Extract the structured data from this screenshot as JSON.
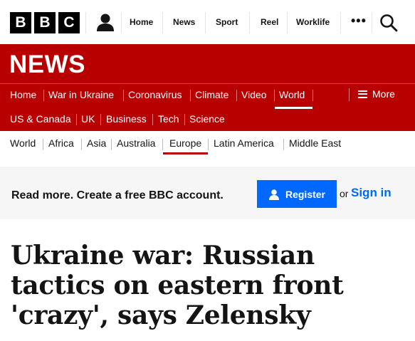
{
  "brand": {
    "logo_letters": [
      "B",
      "B",
      "C"
    ]
  },
  "top_nav": {
    "items": [
      "Home",
      "News",
      "Sport",
      "Reel",
      "Worklife"
    ],
    "more": "•••"
  },
  "news": {
    "title": "NEWS",
    "nav_row1": [
      "Home",
      "War in Ukraine",
      "Coronavirus",
      "Climate",
      "Video",
      "World"
    ],
    "nav_row2": [
      "US & Canada",
      "UK",
      "Business",
      "Tech",
      "Science"
    ],
    "more_label": "More",
    "active": "World"
  },
  "sub_nav": {
    "items": [
      "World",
      "Africa",
      "Asia",
      "Australia",
      "Europe",
      "Latin America",
      "Middle East"
    ],
    "active": "Europe"
  },
  "account_banner": {
    "text": "Read more. Create a free BBC account.",
    "register_label": "Register",
    "or_text": "or",
    "signin_label": "Sign in"
  },
  "article": {
    "headline": "Ukraine war: Russian tactics on eastern front 'crazy', says Zelensky"
  },
  "colors": {
    "news_red": "#b80000",
    "register_blue": "#0068ff"
  }
}
